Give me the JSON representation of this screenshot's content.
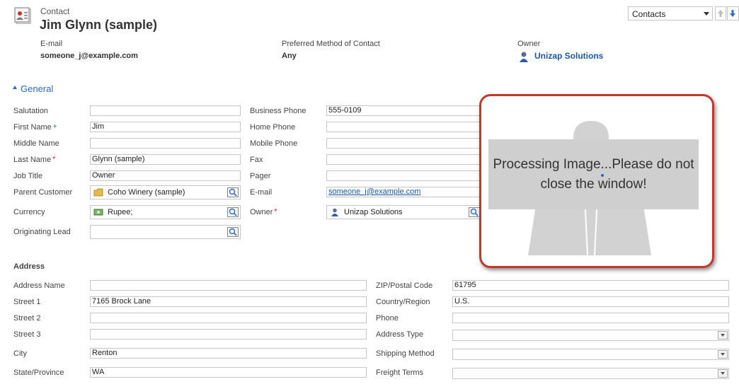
{
  "header": {
    "entity": "Contact",
    "name": "Jim Glynn (sample)",
    "email_label": "E-mail",
    "email_value": "someone_j@example.com",
    "pref_label": "Preferred Method of Contact",
    "pref_value": "Any",
    "owner_label": "Owner",
    "owner_value": "Unizap Solutions",
    "form_selector": "Contacts"
  },
  "general": {
    "title": "General",
    "salutation_label": "Salutation",
    "salutation_value": "",
    "first_name_label": "First Name",
    "first_name_value": "Jim",
    "middle_name_label": "Middle Name",
    "middle_name_value": "",
    "last_name_label": "Last Name",
    "last_name_value": "Glynn (sample)",
    "job_title_label": "Job Title",
    "job_title_value": "Owner",
    "parent_customer_label": "Parent Customer",
    "parent_customer_value": "Coho Winery (sample)",
    "currency_label": "Currency",
    "currency_value": "Rupee;",
    "orig_lead_label": "Originating Lead",
    "orig_lead_value": "",
    "business_phone_label": "Business Phone",
    "business_phone_value": "555-0109",
    "home_phone_label": "Home Phone",
    "mobile_phone_label": "Mobile Phone",
    "fax_label": "Fax",
    "pager_label": "Pager",
    "email_label": "E-mail",
    "email_value": "someone_j@example.com",
    "owner_label": "Owner",
    "owner_value": "Unizap Solutions"
  },
  "overlay": {
    "message": "Processing Image...Please do not close the window!"
  },
  "address": {
    "title": "Address",
    "address_name_label": "Address Name",
    "street1_label": "Street 1",
    "street1_value": "7165 Brock Lane",
    "street2_label": "Street 2",
    "street3_label": "Street 3",
    "city_label": "City",
    "city_value": "Renton",
    "state_label": "State/Province",
    "state_value": "WA",
    "zip_label": "ZIP/Postal Code",
    "zip_value": "61795",
    "country_label": "Country/Region",
    "country_value": "U.S.",
    "phone_label": "Phone",
    "address_type_label": "Address Type",
    "shipping_label": "Shipping Method",
    "freight_label": "Freight Terms"
  },
  "colors": {
    "link": "#1a5aa8",
    "overlay_border": "#c0392b",
    "overlay_bg": "#d0d0d0",
    "required": "#cc0000"
  }
}
